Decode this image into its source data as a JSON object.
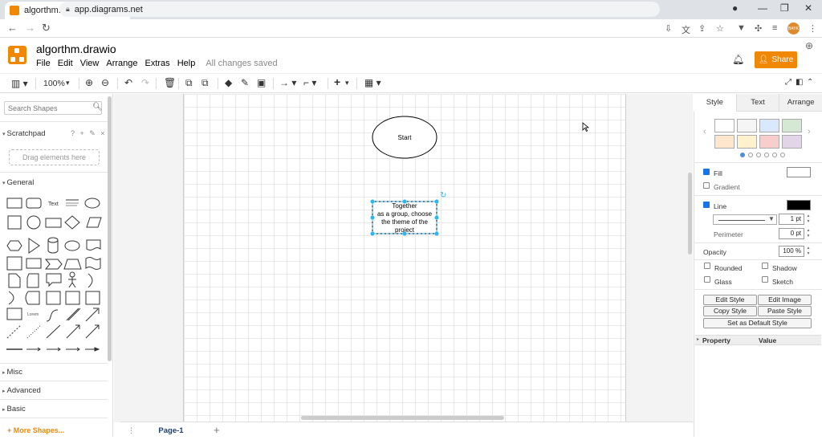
{
  "browser": {
    "tab_title": "algorthm.drawio - diagrams.net",
    "url": "app.diagrams.net",
    "avatar_text": "BAYK"
  },
  "app": {
    "title": "algorthm.drawio",
    "menu": [
      "File",
      "Edit",
      "View",
      "Arrange",
      "Extras",
      "Help"
    ],
    "save_status": "All changes saved",
    "share_label": "Share"
  },
  "toolbar": {
    "zoom": "100%"
  },
  "sidebar": {
    "search_placeholder": "Search Shapes",
    "scratchpad": "Scratchpad",
    "scratchpad_icons": "? + ✎ ×",
    "drag_hint": "Drag elements here",
    "general": "General",
    "shape_text_label": "Text",
    "misc": "Misc",
    "advanced": "Advanced",
    "basic": "Basic",
    "more_shapes": "More Shapes..."
  },
  "canvas": {
    "start_label": "Start",
    "process_label": "Together as a group, choose the theme of the project",
    "process_lines": [
      "Together",
      "as a group, choose",
      "the theme of the",
      "project"
    ],
    "page_tab": "Page-1"
  },
  "format_panel": {
    "tabs": [
      "Style",
      "Text",
      "Arrange"
    ],
    "swatch_colors": [
      "#ffffff",
      "#f5f5f5",
      "#dae8fc",
      "#d5e8d4",
      "#ffe6cc",
      "#fff2cc",
      "#f8cecc",
      "#e1d5e7"
    ],
    "fill_label": "Fill",
    "fill_color": "#ffffff",
    "gradient_label": "Gradient",
    "line_label": "Line",
    "line_color": "#000000",
    "line_width": "1 pt",
    "perimeter_label": "Perimeter",
    "perimeter_value": "0 pt",
    "opacity_label": "Opacity",
    "opacity_value": "100 %",
    "rounded": "Rounded",
    "shadow": "Shadow",
    "glass": "Glass",
    "sketch": "Sketch",
    "edit_style": "Edit Style",
    "edit_image": "Edit Image",
    "copy_style": "Copy Style",
    "paste_style": "Paste Style",
    "default_style": "Set as Default Style",
    "property_header": "Property",
    "value_header": "Value"
  }
}
